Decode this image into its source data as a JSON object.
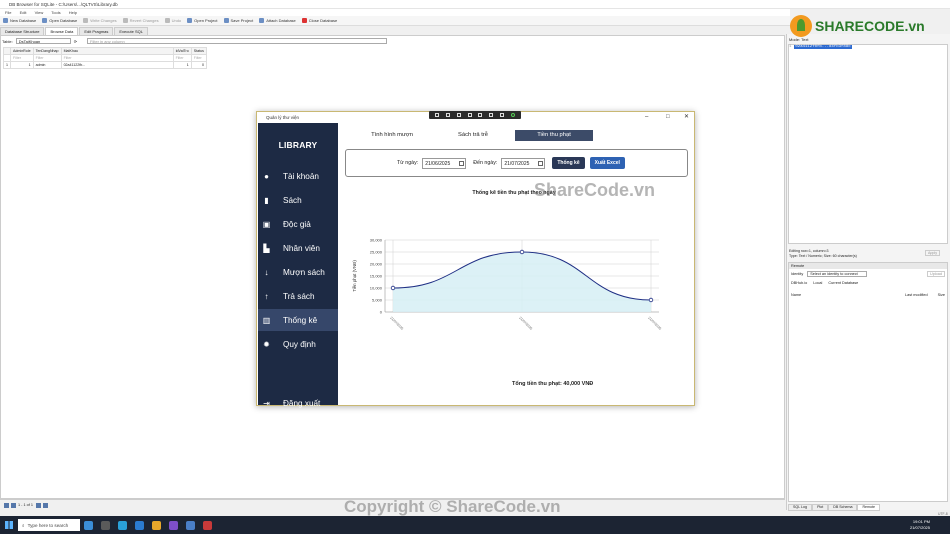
{
  "app": {
    "title": "DB Browser for SQLite - C:\\Users\\...\\QLTVS\\Library.db",
    "menu": [
      "File",
      "Edit",
      "View",
      "Tools",
      "Help"
    ],
    "toolbar": [
      "New Database",
      "Open Database",
      "Write Changes",
      "Revert Changes",
      "Undo",
      "Open Project",
      "Save Project",
      "Attach Database",
      "Close Database"
    ],
    "tabs": [
      "Database Structure",
      "Browse Data",
      "Edit Pragmas",
      "Execute SQL"
    ],
    "table_label": "Table:",
    "table_select": "DsTaiKhoan",
    "filter_placeholder": "Filter in any column",
    "grid": {
      "columns": [
        "AdminRole",
        "TenDangNhap",
        "MatKhau",
        "IdVaiTro",
        "Status"
      ],
      "filter": "Filter",
      "rows": [
        [
          "1",
          "admin",
          "02a41122fb...",
          "1",
          "0"
        ]
      ]
    },
    "status": "1 - 1 of 1"
  },
  "right": {
    "mode_label": "Mode: Text",
    "cell_value": "02a4112f0fb...d4fb3f88c",
    "cell_info": "Editing row=1, column=3",
    "cell_type": "Type: Text / Numeric; Size: 60 character(s)",
    "apply": "Apply",
    "remote_title": "Remote",
    "identity_label": "Identity",
    "identity_value": "Select an identity to connect",
    "upload": "Upload",
    "remote_tabs": [
      "DBHub.io",
      "Local",
      "Current Database"
    ],
    "col_name": "Name",
    "col_modified": "Last modified",
    "col_size": "Size",
    "bottom_tabs": [
      "SQL Log",
      "Plot",
      "DB Schema",
      "Remote"
    ],
    "encoding": "UTF-8"
  },
  "logo": {
    "text": "SHARECODE.vn"
  },
  "watermark": {
    "center": "ShareCode.vn",
    "bottom": "Copyright © ShareCode.vn"
  },
  "taskbar": {
    "search": "Type here to search",
    "time": "19:01 PM",
    "date": "21/07/2025"
  },
  "dialog": {
    "title": "Quản lý thư viện",
    "logo": "LIBRARY",
    "menu": [
      {
        "label": "Tài khoản",
        "icon": "user-icon"
      },
      {
        "label": "Sách",
        "icon": "book-icon"
      },
      {
        "label": "Độc giả",
        "icon": "reader-icon"
      },
      {
        "label": "Nhân viên",
        "icon": "staff-icon"
      },
      {
        "label": "Mượn sách",
        "icon": "borrow-icon"
      },
      {
        "label": "Trả sách",
        "icon": "return-icon"
      },
      {
        "label": "Thống kê",
        "icon": "stats-icon"
      },
      {
        "label": "Quy định",
        "icon": "gear-icon"
      }
    ],
    "logout": "Đăng xuất",
    "tabs": [
      "Tình hình mượn",
      "Sách trả trễ",
      "Tiền thu phạt"
    ],
    "from_label": "Từ ngày:",
    "from_date": "21/06/2025",
    "to_label": "Đến ngày:",
    "to_date": "21/07/2025",
    "stats_btn": "Thống kê",
    "excel_btn": "Xuất Excel",
    "total": "Tổng tiền thu phạt: 40,000 VNĐ"
  },
  "chart_data": {
    "type": "area",
    "title": "Thống kê tiền thu phạt theo ngày",
    "ylabel": "Tiền phạt (VNĐ)",
    "x": [
      "21/07/2025",
      "21/07/2025",
      "21/07/2025"
    ],
    "values": [
      10000,
      25000,
      5000
    ],
    "ylim": [
      0,
      30000
    ],
    "yticks": [
      "0",
      "5,000",
      "10,000",
      "15,000",
      "20,000",
      "25,000",
      "30,000"
    ],
    "grid": true,
    "colors": {
      "line": "#1e2e84",
      "fill": "#d6eef5"
    }
  }
}
